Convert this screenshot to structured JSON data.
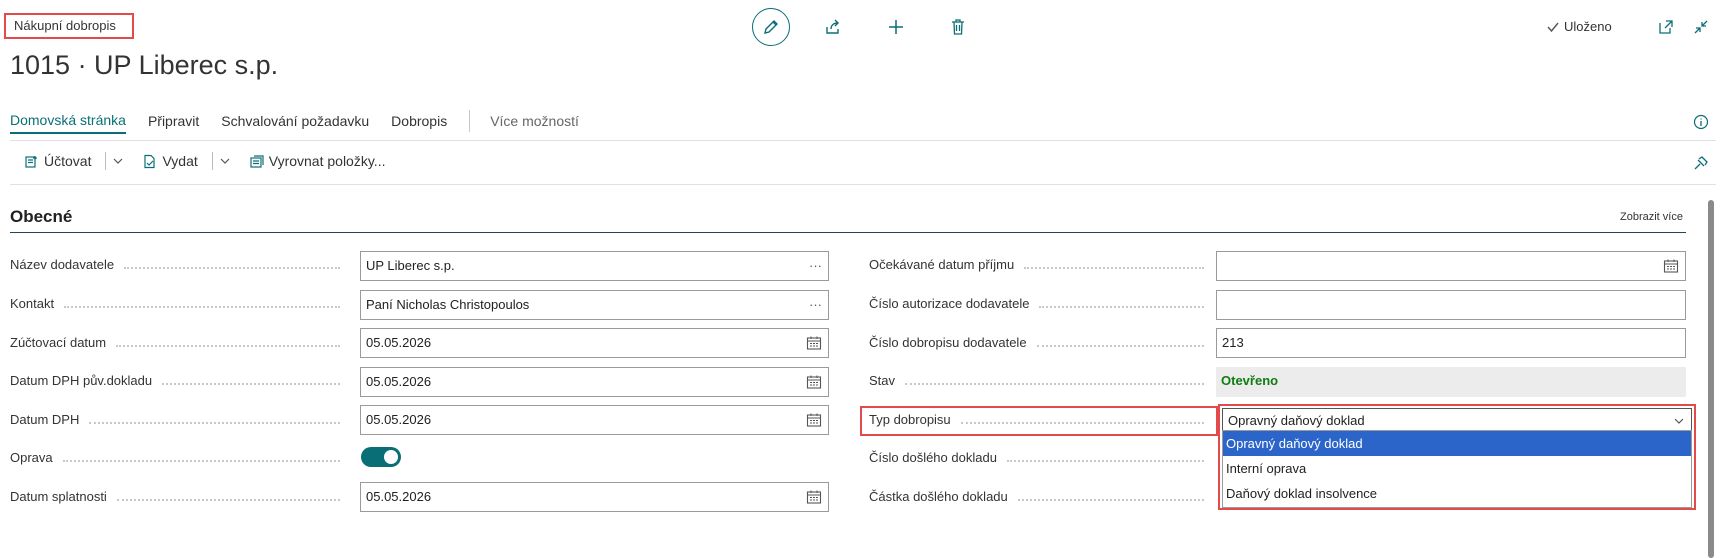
{
  "header": {
    "breadcrumb": "Nákupní dobropis",
    "title": "1015 · UP Liberec s.p.",
    "saved_label": "Uloženo"
  },
  "tabs": [
    {
      "label": "Domovská stránka",
      "active": true
    },
    {
      "label": "Připravit"
    },
    {
      "label": "Schvalování požadavku"
    },
    {
      "label": "Dobropis"
    },
    {
      "label": "Více možností"
    }
  ],
  "actions": {
    "post": "Účtovat",
    "release": "Vydat",
    "apply": "Vyrovnat položky..."
  },
  "section": {
    "title": "Obecné",
    "show_more": "Zobrazit více"
  },
  "left_fields": [
    {
      "label": "Název dodavatele",
      "value": "UP Liberec s.p."
    },
    {
      "label": "Kontakt",
      "value": "Paní Nicholas Christopoulos"
    },
    {
      "label": "Zúčtovací datum",
      "value": "05.05.2026"
    },
    {
      "label": "Datum DPH pův.dokladu",
      "value": "05.05.2026"
    },
    {
      "label": "Datum DPH",
      "value": "05.05.2026"
    },
    {
      "label": "Oprava",
      "value": true
    },
    {
      "label": "Datum splatnosti",
      "value": "05.05.2026"
    }
  ],
  "right_fields": [
    {
      "label": "Očekávané datum příjmu",
      "value": ""
    },
    {
      "label": "Číslo autorizace dodavatele",
      "value": ""
    },
    {
      "label": "Číslo dobropisu dodavatele",
      "value": "213"
    },
    {
      "label": "Stav",
      "value": "Otevřeno"
    },
    {
      "label": "Typ dobropisu",
      "value": "Opravný daňový doklad"
    },
    {
      "label": "Číslo došlého dokladu",
      "value": ""
    },
    {
      "label": "Částka došlého dokladu",
      "value": ""
    }
  ],
  "dropdown_options": [
    "Opravný daňový doklad",
    "Interní oprava",
    "Daňový doklad insolvence"
  ],
  "colors": {
    "accent": "#0a6e76",
    "highlight": "#e34a4a",
    "selection": "#2b65c9",
    "status_open": "#107c10"
  }
}
